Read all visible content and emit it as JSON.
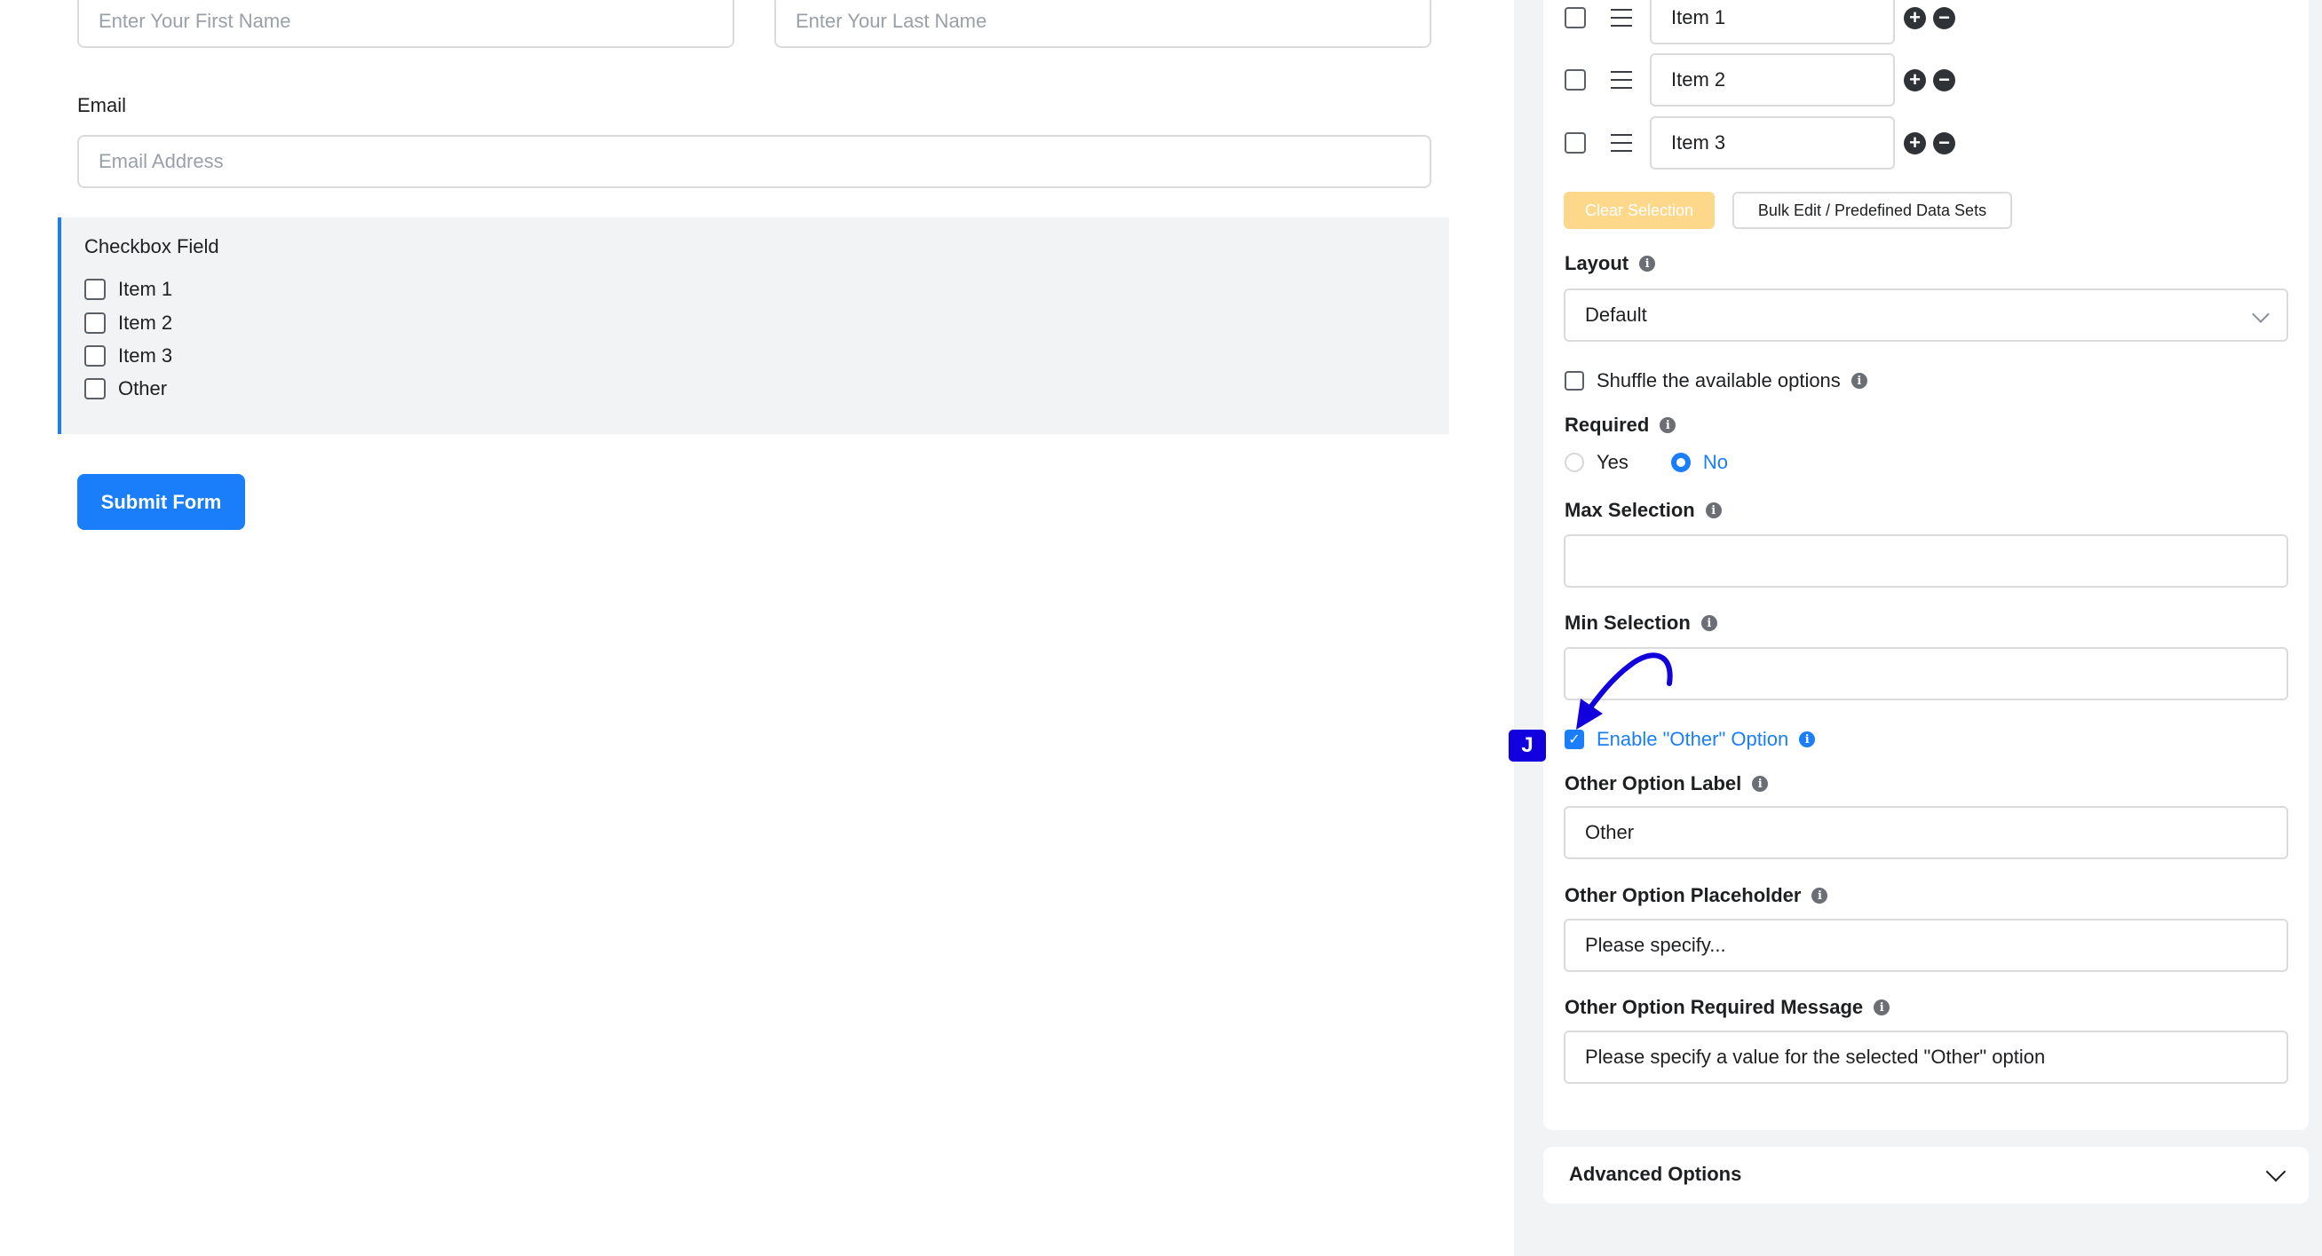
{
  "form": {
    "first_name_placeholder": "Enter Your First Name",
    "last_name_placeholder": "Enter Your Last Name",
    "email_label": "Email",
    "email_placeholder": "Email Address",
    "checkbox_field": {
      "title": "Checkbox Field",
      "items": [
        "Item 1",
        "Item 2",
        "Item 3",
        "Other"
      ]
    },
    "submit_label": "Submit Form"
  },
  "settings": {
    "options": [
      {
        "value": "Item 1"
      },
      {
        "value": "Item 2"
      },
      {
        "value": "Item 3"
      }
    ],
    "clear_selection_label": "Clear Selection",
    "bulk_edit_label": "Bulk Edit / Predefined Data Sets",
    "layout_label": "Layout",
    "layout_value": "Default",
    "shuffle_label": "Shuffle the available options",
    "required_label": "Required",
    "required_yes": "Yes",
    "required_no": "No",
    "max_selection_label": "Max Selection",
    "min_selection_label": "Min Selection",
    "enable_other_label": "Enable \"Other\" Option",
    "other_label_label": "Other Option Label",
    "other_label_value": "Other",
    "other_placeholder_label": "Other Option Placeholder",
    "other_placeholder_value": "Please specify...",
    "other_required_label": "Other Option Required Message",
    "other_required_value": "Please specify a value for the selected \"Other\" option",
    "advanced_options_label": "Advanced Options"
  },
  "annotation": {
    "badge": "J",
    "arrow_color": "#1100dd"
  },
  "colors": {
    "accent": "#1a7efb",
    "clear_button": "#fdd78a"
  }
}
